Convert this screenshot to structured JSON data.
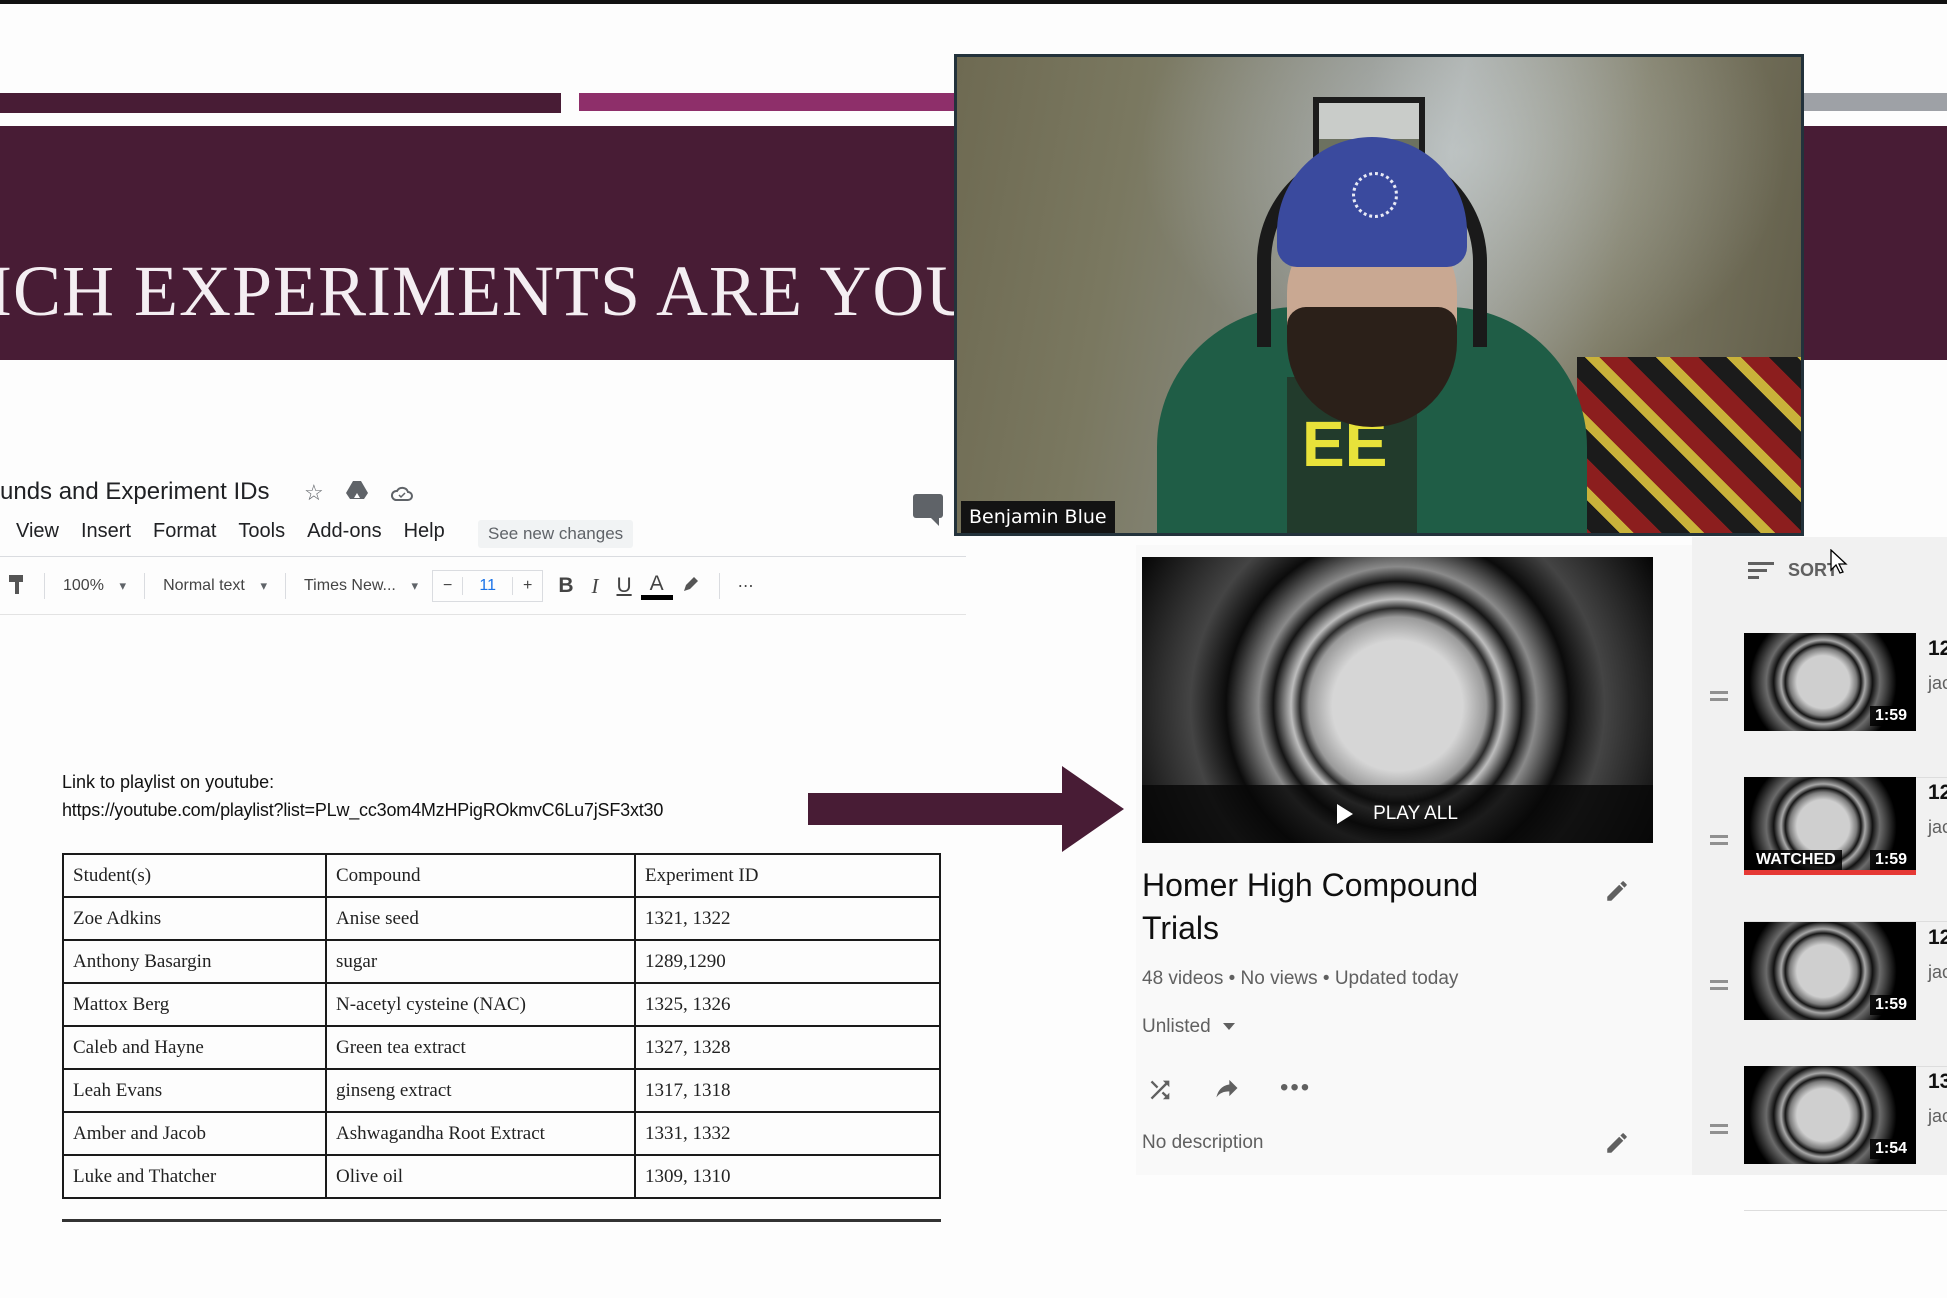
{
  "slide": {
    "title": "ICH EXPERIMENTS ARE YOUR",
    "colors": {
      "banner": "#481c35",
      "accent_magenta": "#8e2f6a",
      "accent_grey": "#9ea1a6"
    }
  },
  "webcam": {
    "participant_name": "Benjamin Blue",
    "jersey_text": "EE"
  },
  "docs": {
    "title": "unds and Experiment IDs",
    "icons": [
      "star-icon",
      "drive-move-icon",
      "cloud-saved-icon",
      "comment-icon"
    ],
    "menu": [
      "View",
      "Insert",
      "Format",
      "Tools",
      "Add-ons",
      "Help"
    ],
    "see_new_changes": "See new changes",
    "toolbar": {
      "paint_format_icon": "paint-format-icon",
      "zoom": "100%",
      "style": "Normal text",
      "font": "Times New...",
      "font_size": "11",
      "decrease": "−",
      "increase": "+",
      "bold": "B",
      "italic": "I",
      "underline": "U",
      "text_color": "A",
      "highlight_icon": "highlighter-icon",
      "more": "⋯"
    },
    "link_label": "Link to playlist on youtube:",
    "link_url": "https://youtube.com/playlist?list=PLw_cc3om4MzHPigROkmvC6Lu7jSF3xt30",
    "table": {
      "headers": [
        "Student(s)",
        "Compound",
        "Experiment ID"
      ],
      "rows": [
        [
          "Zoe Adkins",
          "Anise seed",
          "1321, 1322"
        ],
        [
          "Anthony Basargin",
          "sugar",
          "1289,1290"
        ],
        [
          "Mattox Berg",
          "N-acetyl cysteine (NAC)",
          "1325, 1326"
        ],
        [
          "Caleb and Hayne",
          "Green tea extract",
          "1327, 1328"
        ],
        [
          "Leah Evans",
          "ginseng extract",
          "1317, 1318"
        ],
        [
          "Amber and Jacob",
          "Ashwagandha Root Extract",
          "1331, 1332"
        ],
        [
          "Luke and Thatcher",
          "Olive oil",
          "1309, 1310"
        ]
      ]
    }
  },
  "youtube": {
    "play_all": "PLAY ALL",
    "playlist_title": "Homer High Compound Trials",
    "meta": "48 videos • No views • Updated today",
    "privacy": "Unlisted",
    "description": "No description",
    "sort_label": "SORT",
    "videos": [
      {
        "title": "12",
        "channel": "jac",
        "duration": "1:59",
        "watched": false
      },
      {
        "title": "12",
        "channel": "jac",
        "duration": "1:59",
        "watched": true,
        "watched_label": "WATCHED",
        "progress": 1.0
      },
      {
        "title": "12",
        "channel": "jac",
        "duration": "1:59",
        "watched": false
      },
      {
        "title": "13",
        "channel": "jac",
        "duration": "1:54",
        "watched": false
      }
    ],
    "accent_red": "#e53935"
  }
}
